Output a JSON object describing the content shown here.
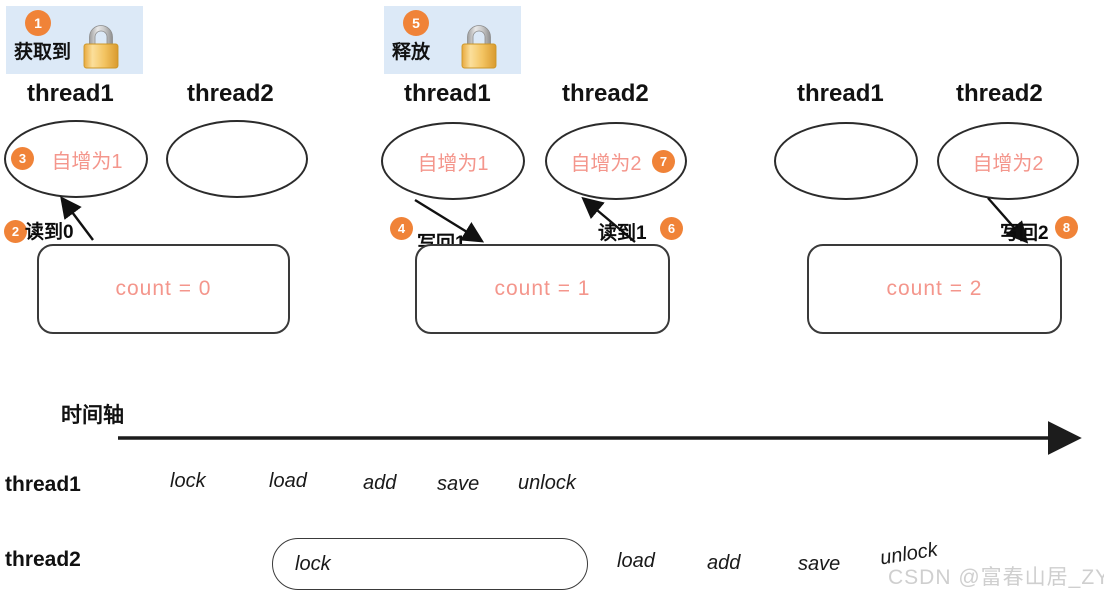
{
  "colors": {
    "badge": "#f08338",
    "highlight_bg": "#dce9f7",
    "accent_text": "#f4968c",
    "stroke": "#2b2b2b",
    "watermark": "#cfcfcf"
  },
  "lock_chips": [
    {
      "badge": "1",
      "label": "获取到",
      "icon": "lock-icon"
    },
    {
      "badge": "5",
      "label": "释放",
      "icon": "lock-icon"
    }
  ],
  "panels": [
    {
      "thread1_heading": "thread1",
      "thread2_heading": "thread2",
      "ellipse_left": "自增为1",
      "ellipse_right": "",
      "count_text": "count = 0",
      "edges": [
        {
          "badge": "2",
          "label": "读到0"
        },
        {
          "badge": "3",
          "label": ""
        }
      ]
    },
    {
      "thread1_heading": "thread1",
      "thread2_heading": "thread2",
      "ellipse_left": "自增为1",
      "ellipse_right": "自增为2",
      "count_text": "count = 1",
      "edges": [
        {
          "badge": "4",
          "label": "写回1"
        },
        {
          "badge": "6",
          "label": "读到1"
        },
        {
          "badge": "7",
          "label": ""
        }
      ]
    },
    {
      "thread1_heading": "thread1",
      "thread2_heading": "thread2",
      "ellipse_left": "",
      "ellipse_right": "自增为2",
      "count_text": "count = 2",
      "edges": [
        {
          "badge": "8",
          "label": "写回2"
        }
      ]
    }
  ],
  "badges": {
    "b1": "1",
    "b2": "2",
    "b3": "3",
    "b4": "4",
    "b5": "5",
    "b6": "6",
    "b7": "7",
    "b8": "8"
  },
  "timeline": {
    "axis_title": "时间轴",
    "rows": [
      {
        "label": "thread1",
        "ops": [
          "lock",
          "load",
          "add",
          "save",
          "unlock"
        ]
      },
      {
        "label": "thread2",
        "blocked_op": "lock",
        "ops": [
          "load",
          "add",
          "save",
          "unlock"
        ]
      }
    ]
  },
  "watermark": "CSDN @富春山居_ZYY"
}
